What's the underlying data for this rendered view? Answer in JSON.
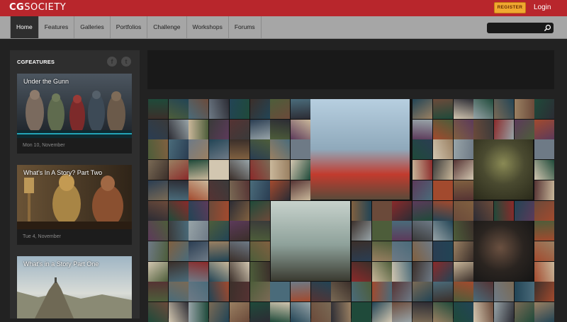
{
  "header": {
    "logo_bold": "CG",
    "logo_thin": "SOCIETY",
    "register_label": "REGISTER",
    "login_label": "Login",
    "brand_color": "#b8262c",
    "register_color": "#f0a830"
  },
  "nav": {
    "items": [
      "Home",
      "Features",
      "Galleries",
      "Portfolios",
      "Challenge",
      "Workshops",
      "Forums"
    ],
    "active": "Home",
    "search_placeholder": ""
  },
  "sidebar": {
    "section_title": "CGFEATURES",
    "social_icons": [
      "facebook-icon",
      "twitter-icon"
    ],
    "cards": [
      {
        "title": "Under the Gunn",
        "date": "Mon 10, November"
      },
      {
        "title": "What's In A Story? Part Two",
        "date": "Tue 4, November"
      },
      {
        "title": "What's in a Story Part One",
        "date": ""
      }
    ]
  }
}
